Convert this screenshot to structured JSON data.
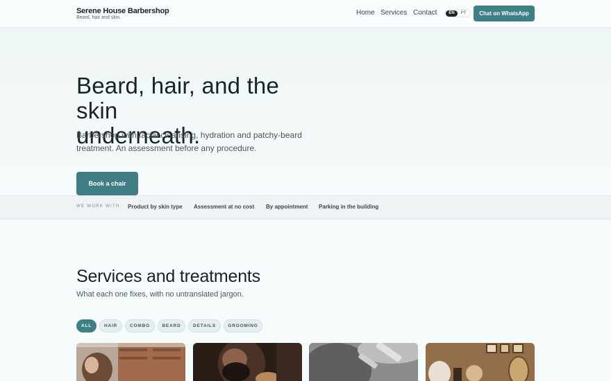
{
  "header": {
    "brand_name": "Serene House Barbershop",
    "brand_tagline": "Beard, hair and skin.",
    "nav": [
      "Home",
      "Services",
      "Contact"
    ],
    "lang": [
      "EN",
      "PT"
    ],
    "lang_active": "EN",
    "cta": "Chat on WhatsApp"
  },
  "hero": {
    "title_line1": "Beard, hair, and the skin",
    "title_line2": "underneath.",
    "subtitle": "Barbershop with facial cleansing, hydration and patchy-beard treatment. An assessment before any procedure.",
    "button": "Book a chair"
  },
  "strip": {
    "label": "WE WORK WITH",
    "items": [
      "Product by skin type",
      "Assessment at no cost",
      "By appointment",
      "Parking in the building"
    ]
  },
  "services": {
    "title": "Services and treatments",
    "subtitle": "What each one fixes, with no untranslated jargon.",
    "filters": [
      "ALL",
      "HAIR",
      "COMBO",
      "BEARD",
      "DETAILS",
      "GROOMING"
    ],
    "active_filter": "ALL"
  },
  "colors": {
    "accent": "#3f7f86",
    "background": "#f6fcfc",
    "text": "#1b2224"
  }
}
